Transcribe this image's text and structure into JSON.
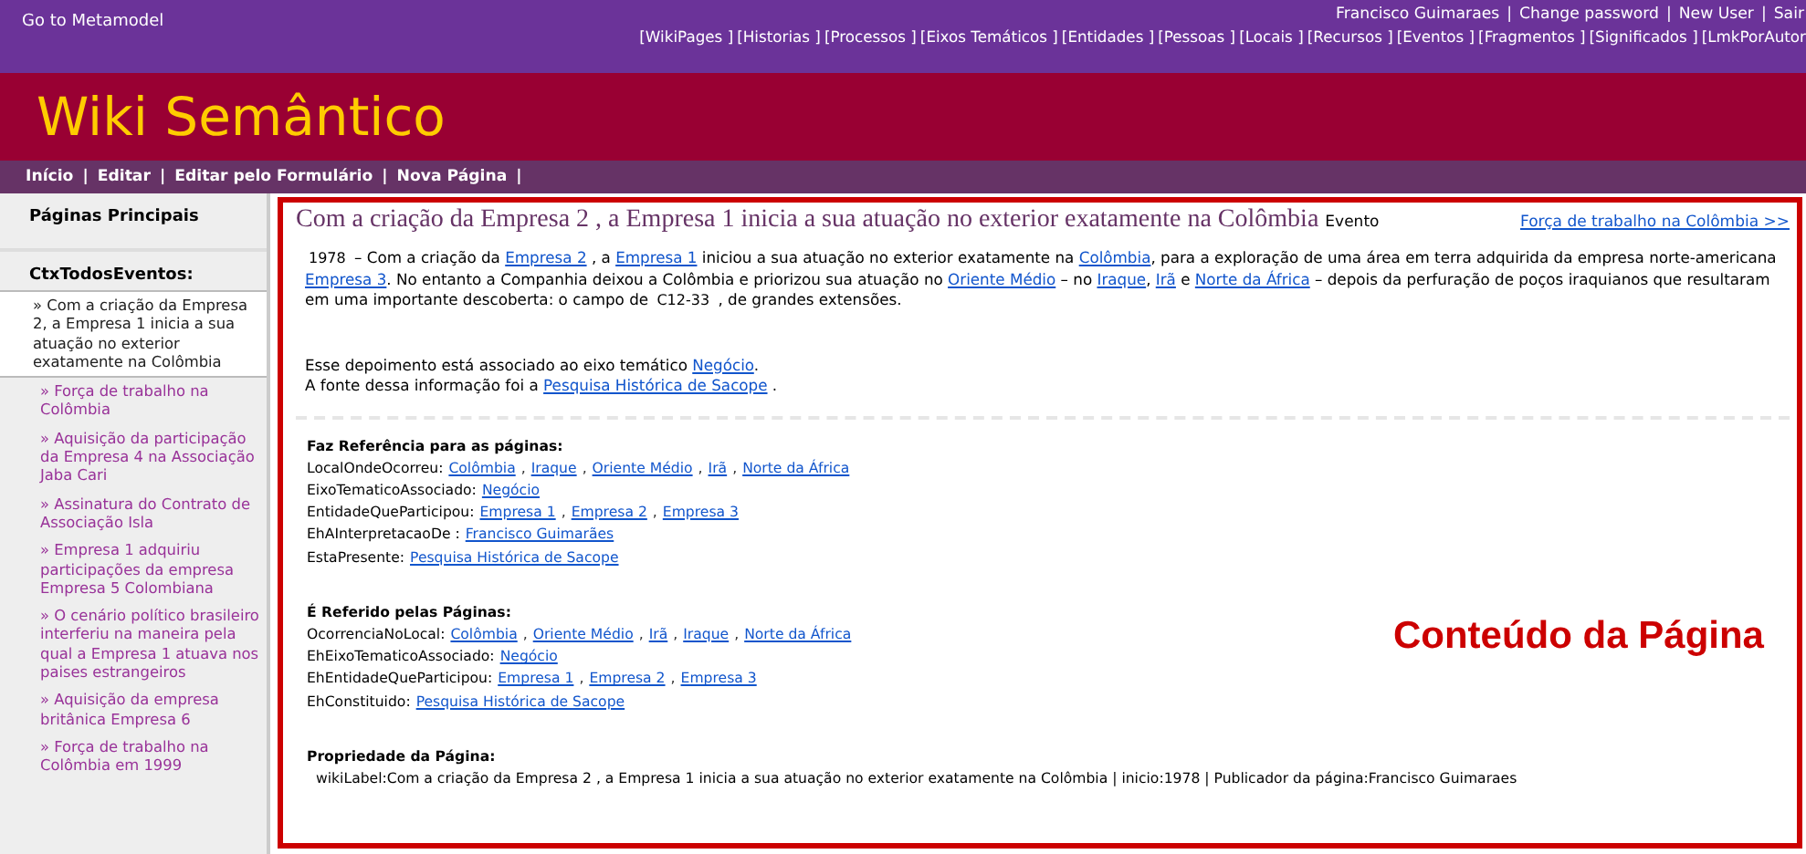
{
  "top_bar": {
    "metamodel_link": "Go to Metamodel",
    "user_links": [
      "Francisco Guimaraes",
      "Change password",
      "New User",
      "Sair"
    ],
    "separator": "|",
    "nav_links": [
      "[WikiPages ]",
      "[Historias ]",
      "[Processos ]",
      "[Eixos Temáticos ]",
      "[Entidades ]",
      "[Pessoas ]",
      "[Locais ]",
      "[Recursos ]",
      "[Eventos ]",
      "[Fragmentos ]",
      "[Significados ]",
      "[LmkPorAutor"
    ]
  },
  "site_title": "Wiki Semântico",
  "menu": {
    "items": [
      "Início",
      "Editar",
      "Editar pelo Formulário",
      "Nova Página"
    ],
    "separator": "|"
  },
  "sidebar": {
    "heading": "Páginas Principais",
    "section": "CtxTodosEventos:",
    "items": [
      {
        "label": "» Com a criação da Empresa 2, a Empresa 1 inicia a sua atuação no exterior exatamente na Colômbia",
        "selected": true
      },
      {
        "label": "» Força de trabalho na Colômbia",
        "selected": false
      },
      {
        "label": "» Aquisição da participação da Empresa 4 na Associação Jaba Cari",
        "selected": false
      },
      {
        "label": "» Assinatura do Contrato de Associação Isla",
        "selected": false
      },
      {
        "label": "» Empresa 1 adquiriu participações da empresa Empresa 5 Colombiana",
        "selected": false
      },
      {
        "label": "» O cenário político brasileiro interferiu na maneira pela qual a Empresa 1 atuava nos paises estrangeiros",
        "selected": false
      },
      {
        "label": "» Aquisição da empresa britânica Empresa 6",
        "selected": false
      },
      {
        "label": "» Força de trabalho na Colômbia em 1999",
        "selected": false
      }
    ]
  },
  "content": {
    "title": "Com a criação da Empresa 2 , a Empresa 1 inicia a sua atuação no exterior exatamente na Colômbia",
    "type_label": "Evento",
    "next_link": "Força de trabalho na Colômbia >>",
    "paragraphs": [
      [
        {
          "kind": "small",
          "text": "1978"
        },
        {
          "kind": "text",
          "text": " – Com a criação da "
        },
        {
          "kind": "link",
          "text": "Empresa 2"
        },
        {
          "kind": "text",
          "text": " , a "
        },
        {
          "kind": "link",
          "text": "Empresa 1"
        },
        {
          "kind": "text",
          "text": " iniciou a sua atuação no exterior exatamente na "
        },
        {
          "kind": "link",
          "text": "Colômbia"
        },
        {
          "kind": "text",
          "text": ", para a exploração de uma área em terra adquirida da empresa norte-americana "
        },
        {
          "kind": "link",
          "text": "Empresa 3"
        },
        {
          "kind": "text",
          "text": ". No entanto a Companhia deixou a Colômbia e priorizou sua atuação no "
        },
        {
          "kind": "link",
          "text": "Oriente Médio"
        },
        {
          "kind": "text",
          "text": " – no "
        },
        {
          "kind": "link",
          "text": "Iraque"
        },
        {
          "kind": "text",
          "text": ", "
        },
        {
          "kind": "link",
          "text": "Irã"
        },
        {
          "kind": "text",
          "text": " e "
        },
        {
          "kind": "link",
          "text": "Norte da África"
        },
        {
          "kind": "text",
          "text": " – depois da perfuração de poços iraquianos que resultaram em uma importante descoberta: o campo de "
        },
        {
          "kind": "small",
          "text": "C12-33"
        },
        {
          "kind": "text",
          "text": " , de grandes extensões."
        }
      ],
      [
        {
          "kind": "text",
          "text": "Esse depoimento está associado ao eixo temático "
        },
        {
          "kind": "link",
          "text": "Negócio"
        },
        {
          "kind": "text",
          "text": "."
        }
      ],
      [
        {
          "kind": "text",
          "text": "A fonte dessa informação foi a "
        },
        {
          "kind": "link",
          "text": "Pesquisa Histórica de Sacope"
        },
        {
          "kind": "text",
          "text": " ."
        }
      ]
    ],
    "references": {
      "heading": "Faz Referência para as páginas:",
      "rows": [
        {
          "label": "LocalOndeOcorreu:",
          "separator": ",",
          "values": [
            "Colômbia",
            "Iraque",
            "Oriente Médio",
            "Irã",
            "Norte da África"
          ]
        },
        {
          "label": "EixoTematicoAssociado:",
          "values": [
            "Negócio"
          ]
        },
        {
          "label": "EntidadeQueParticipou:",
          "separator": ",",
          "values": [
            "Empresa 1",
            "Empresa 2",
            "Empresa 3"
          ]
        },
        {
          "label": "EhAInterpretacaoDe :",
          "values": [
            "Francisco Guimarães"
          ]
        },
        {
          "label": "EstaPresente:",
          "values": [
            "Pesquisa Histórica de Sacope"
          ]
        }
      ]
    },
    "referred_by": {
      "heading": "É Referido pelas Páginas:",
      "rows": [
        {
          "label": "OcorrenciaNoLocal:",
          "separator": ",",
          "values": [
            "Colômbia",
            "Oriente Médio",
            "Irã",
            "Iraque",
            "Norte da África"
          ]
        },
        {
          "label": "EhEixoTematicoAssociado:",
          "values": [
            "Negócio"
          ]
        },
        {
          "label": "EhEntidadeQueParticipou:",
          "separator": ",",
          "values": [
            "Empresa 1",
            "Empresa 2",
            "Empresa 3"
          ]
        },
        {
          "label": "EhConstituido:",
          "values": [
            "Pesquisa Histórica de Sacope"
          ]
        }
      ]
    },
    "annotation": "Conteúdo da Página",
    "properties": {
      "heading": "Propriedade da Página:",
      "text": "wikiLabel:Com a criação da Empresa 2 , a Empresa 1 inicia a sua atuação no exterior exatamente na Colômbia | inicio:1978 | Publicador da página:Francisco Guimaraes"
    }
  }
}
